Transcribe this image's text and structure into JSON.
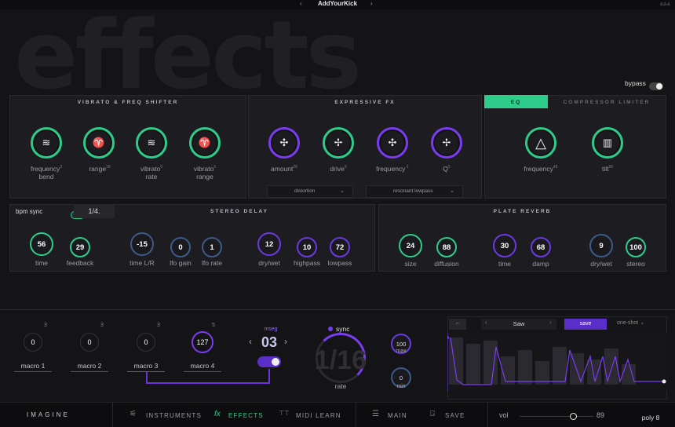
{
  "topbar": {
    "preset_name": "AddYourKick",
    "prev": "‹",
    "next": "›",
    "corner": "⩓⩓⩓"
  },
  "background_word": "effects",
  "bypass": {
    "label": "bypass",
    "state": "off"
  },
  "vibrato": {
    "title": "VIBRATO & FREQ SHIFTER",
    "knobs": [
      {
        "label": "frequency",
        "sup": "3",
        "label2": "bend",
        "icon": "≋"
      },
      {
        "label": "range",
        "sup": "28",
        "label2": "",
        "icon": "♈"
      },
      {
        "label": "vibrato",
        "sup": "0",
        "label2": "rate",
        "icon": "≋"
      },
      {
        "label": "vibrato",
        "sup": "5",
        "label2": "range",
        "icon": "♈"
      }
    ]
  },
  "expressive": {
    "title": "EXPRESSIVE FX",
    "knobs": [
      {
        "label": "amount",
        "sup": "28",
        "icon": "✣"
      },
      {
        "label": "drive",
        "sup": "8",
        "icon": "✢"
      },
      {
        "label": "frequency",
        "sup": "-1",
        "icon": "✣"
      },
      {
        "label": "Q",
        "sup": "5",
        "icon": "✢"
      }
    ],
    "distortion_type": "distortion",
    "filter_type": "resonant lowpass"
  },
  "eq": {
    "tab_eq": "EQ",
    "tab_comp": "COMPRESSOR LIMITER",
    "knobs": [
      {
        "label": "frequency",
        "sup": "48",
        "icon": "△"
      },
      {
        "label": "tilt",
        "sup": "88",
        "icon": "▥"
      }
    ]
  },
  "delay": {
    "title": "STEREO DELAY",
    "bpm_sync_label": "bpm sync",
    "bpm_sync_state": "on",
    "division": "1/4.",
    "knobs": [
      {
        "label": "time",
        "value": "56"
      },
      {
        "label": "feedback",
        "value": "29"
      },
      {
        "label": "time L/R",
        "value": "-15"
      },
      {
        "label": "lfo gain",
        "value": "0"
      },
      {
        "label": "lfo rate",
        "value": "1"
      },
      {
        "label": "dry/wet",
        "value": "12"
      },
      {
        "label": "highpass",
        "value": "10"
      },
      {
        "label": "lowpass",
        "value": "72"
      }
    ]
  },
  "reverb": {
    "title": "PLATE REVERB",
    "knobs": [
      {
        "label": "size",
        "value": "24"
      },
      {
        "label": "diffusion",
        "value": "88"
      },
      {
        "label": "time",
        "value": "30"
      },
      {
        "label": "damp",
        "value": "68"
      },
      {
        "label": "dry/wet",
        "value": "9"
      },
      {
        "label": "stereo",
        "value": "100"
      }
    ]
  },
  "macros": [
    {
      "label": "macro 1",
      "value": "0",
      "count": "3"
    },
    {
      "label": "macro 2",
      "value": "0",
      "count": "3"
    },
    {
      "label": "macro 3",
      "value": "0",
      "count": "3"
    },
    {
      "label": "macro 4",
      "value": "127",
      "count": "5"
    }
  ],
  "msseg": {
    "label": "mseg",
    "value": "03"
  },
  "rate": {
    "sync_label": "sync",
    "value": "1/16",
    "label": "rate",
    "max_value": "100",
    "max_label": "max",
    "min_value": "0",
    "min_label": "min"
  },
  "lfo_editor": {
    "shape": "Saw",
    "save_label": "save",
    "mode": "one-shot"
  },
  "bottom": {
    "logo": "IMAGINE",
    "instruments": "INSTRUMENTS",
    "effects": "EFFECTS",
    "midi_learn": "MIDI LEARN",
    "main": "MAIN",
    "save": "SAVE",
    "vol_label": "vol",
    "vol_value": "89",
    "vol_level": 0.72,
    "poly": "poly 8"
  },
  "colors": {
    "accent_green": "#2ecc8a",
    "accent_purple": "#7a3cf0"
  }
}
